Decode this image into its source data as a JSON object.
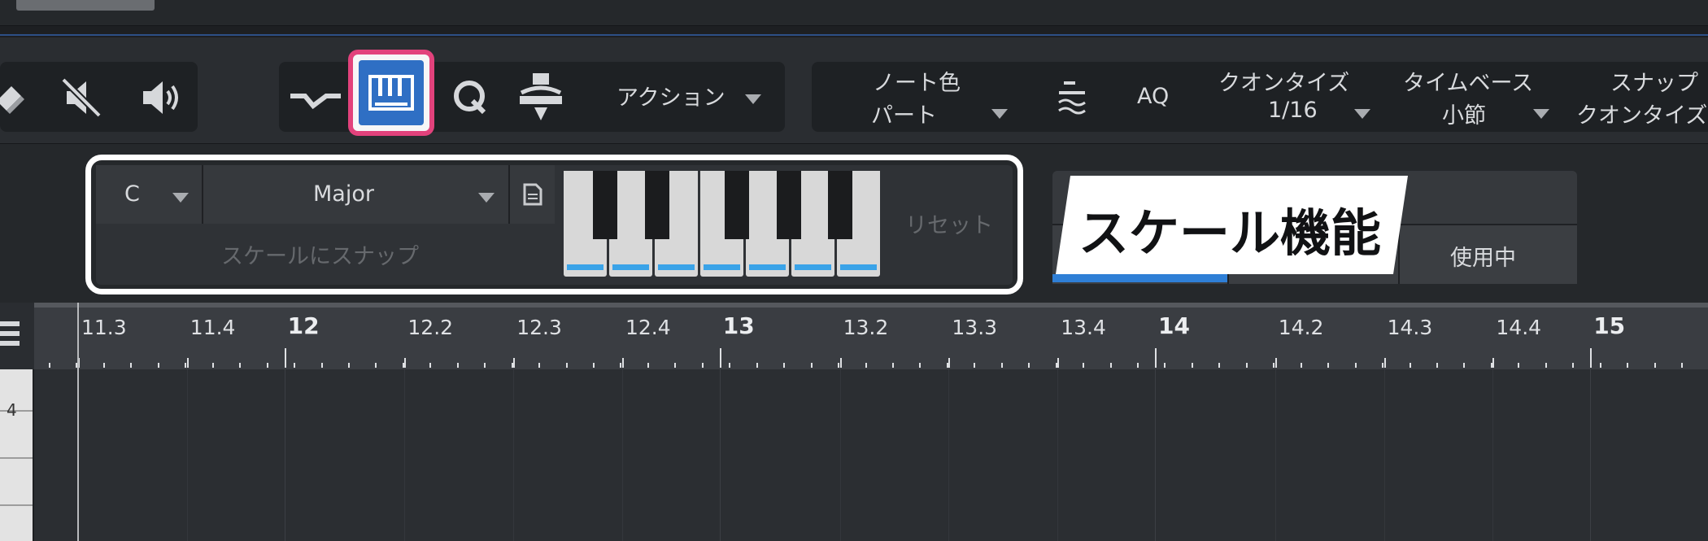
{
  "toolbar": {
    "action_label": "アクション",
    "note_color_label": "ノート色",
    "note_color_value": "パート",
    "aq_label": "AQ",
    "quantize_label": "クオンタイズ",
    "quantize_value": "1/16",
    "timebase_label": "タイムベース",
    "timebase_value": "小節",
    "snap_label": "スナップ",
    "snap_value": "クオンタイズ"
  },
  "scale_panel": {
    "root_note": "C",
    "scale_type": "Major",
    "snap_to_scale_label": "スケールにスナップ",
    "reset_label": "リセット",
    "accent_color": "#3aa3e8",
    "highlight_border_color": "#ffffff"
  },
  "annotation": {
    "title": "スケール機能"
  },
  "right_panel": {
    "in_use_label": "使用中"
  },
  "ruler": {
    "labels": [
      "11.3",
      "11.4",
      "12",
      "12.2",
      "12.3",
      "12.4",
      "13",
      "13.2",
      "13.3",
      "13.4",
      "14",
      "14.2",
      "14.3",
      "14.4",
      "15"
    ]
  },
  "piano": {
    "visible_note_label": "4"
  },
  "colors": {
    "active_button": "#2f6fc4",
    "active_button_outline": "#e2427c"
  }
}
